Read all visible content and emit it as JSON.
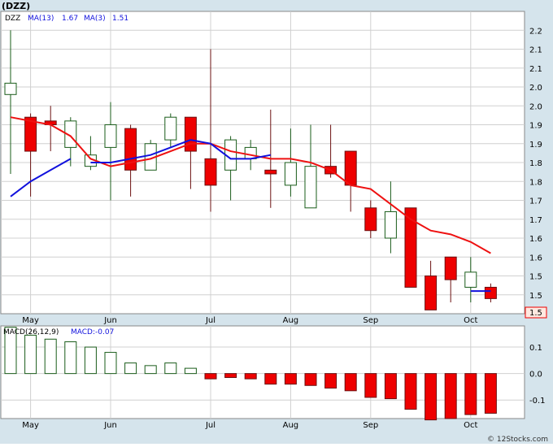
{
  "title": "(DZZ)",
  "colors": {
    "frame_bg": "#d5e4ec",
    "plot_bg": "#ffffff",
    "grid": "#d0d0d0",
    "up": "#1a5c1a",
    "down": "#ee0000",
    "ma13": "#ee1111",
    "ma3": "#1111dd",
    "price_box": "#ffe8e0"
  },
  "legend": {
    "ticker": "DZZ",
    "ma13_label": "MA(13)",
    "ma13_value": "1.67",
    "ma3_label": "MA(3)",
    "ma3_value": "1.51"
  },
  "last_price_label": "1.5",
  "macd_legend": {
    "label": "MACD(26,12,9)",
    "value_label": "MACD:-0.07"
  },
  "watermark": "© 12Stocks.com",
  "x_months": [
    {
      "label": "May",
      "i": 1
    },
    {
      "label": "Jun",
      "i": 5
    },
    {
      "label": "Jul",
      "i": 10
    },
    {
      "label": "Aug",
      "i": 14
    },
    {
      "label": "Sep",
      "i": 18
    },
    {
      "label": "Oct",
      "i": 23
    }
  ],
  "chart_data": [
    {
      "type": "candlestick",
      "ylim": [
        1.46,
        2.26
      ],
      "y_ticks": [
        "1.5",
        "1.5",
        "1.6",
        "1.6",
        "1.7",
        "1.7",
        "1.8",
        "1.8",
        "1.9",
        "1.9",
        "2.0",
        "2.0",
        "2.1",
        "2.1",
        "2.2"
      ],
      "y_tick_values": [
        1.51,
        1.56,
        1.61,
        1.66,
        1.71,
        1.76,
        1.81,
        1.86,
        1.91,
        1.96,
        2.01,
        2.06,
        2.11,
        2.16,
        2.21
      ],
      "candles": [
        {
          "o": 2.04,
          "c": 2.07,
          "h": 2.21,
          "l": 1.83
        },
        {
          "o": 1.98,
          "c": 1.89,
          "h": 1.99,
          "l": 1.77
        },
        {
          "o": 1.97,
          "c": 1.96,
          "h": 2.01,
          "l": 1.89
        },
        {
          "o": 1.9,
          "c": 1.97,
          "h": 1.98,
          "l": 1.85
        },
        {
          "o": 1.85,
          "c": 1.88,
          "h": 1.93,
          "l": 1.84
        },
        {
          "o": 1.9,
          "c": 1.96,
          "h": 2.02,
          "l": 1.76
        },
        {
          "o": 1.95,
          "c": 1.84,
          "h": 1.96,
          "l": 1.77
        },
        {
          "o": 1.84,
          "c": 1.91,
          "h": 1.92,
          "l": 1.84
        },
        {
          "o": 1.92,
          "c": 1.98,
          "h": 1.99,
          "l": 1.9
        },
        {
          "o": 1.98,
          "c": 1.89,
          "h": 1.98,
          "l": 1.79
        },
        {
          "o": 1.87,
          "c": 1.8,
          "h": 2.16,
          "l": 1.73
        },
        {
          "o": 1.84,
          "c": 1.92,
          "h": 1.93,
          "l": 1.76
        },
        {
          "o": 1.87,
          "c": 1.9,
          "h": 1.92,
          "l": 1.84
        },
        {
          "o": 1.84,
          "c": 1.83,
          "h": 2.0,
          "l": 1.74
        },
        {
          "o": 1.8,
          "c": 1.86,
          "h": 1.95,
          "l": 1.77
        },
        {
          "o": 1.74,
          "c": 1.85,
          "h": 1.96,
          "l": 1.74
        },
        {
          "o": 1.85,
          "c": 1.83,
          "h": 1.96,
          "l": 1.82
        },
        {
          "o": 1.89,
          "c": 1.8,
          "h": 1.89,
          "l": 1.73
        },
        {
          "o": 1.74,
          "c": 1.68,
          "h": 1.76,
          "l": 1.66
        },
        {
          "o": 1.66,
          "c": 1.73,
          "h": 1.81,
          "l": 1.62
        },
        {
          "o": 1.74,
          "c": 1.53,
          "h": 1.74,
          "l": 1.53
        },
        {
          "o": 1.56,
          "c": 1.47,
          "h": 1.6,
          "l": 1.47
        },
        {
          "o": 1.61,
          "c": 1.55,
          "h": 1.61,
          "l": 1.49
        },
        {
          "o": 1.53,
          "c": 1.57,
          "h": 1.61,
          "l": 1.49
        },
        {
          "o": 1.53,
          "c": 1.5,
          "h": 1.54,
          "l": 1.49
        }
      ],
      "ma13": [
        1.98,
        1.97,
        1.96,
        1.93,
        1.87,
        1.85,
        1.86,
        1.87,
        1.89,
        1.91,
        1.91,
        1.89,
        1.88,
        1.87,
        1.87,
        1.86,
        1.84,
        1.8,
        1.79,
        1.75,
        1.71,
        1.68,
        1.67,
        1.65,
        1.62
      ],
      "ma3": [
        1.77,
        1.81,
        1.84,
        1.87,
        1.86,
        1.86,
        1.87,
        1.88,
        1.9,
        1.92,
        1.91,
        1.87,
        1.87,
        1.88,
        null,
        null,
        null,
        null,
        null,
        null,
        null,
        null,
        null,
        1.52,
        1.52
      ],
      "ma3_segments": [
        [
          0,
          3
        ],
        [
          4,
          6
        ],
        [
          6,
          9
        ],
        [
          9,
          13
        ],
        [
          22,
          24
        ]
      ]
    },
    {
      "type": "bar",
      "name": "MACD(26,12,9)",
      "ylim": [
        -0.17,
        0.18
      ],
      "y_ticks": [
        "0.1",
        "0.0",
        "-0.1"
      ],
      "y_tick_values": [
        0.1,
        0.0,
        -0.1
      ],
      "values": [
        0.175,
        0.145,
        0.13,
        0.12,
        0.1,
        0.08,
        0.04,
        0.03,
        0.04,
        0.02,
        -0.02,
        -0.015,
        -0.02,
        -0.04,
        -0.04,
        -0.045,
        -0.055,
        -0.065,
        -0.09,
        -0.095,
        -0.135,
        -0.175,
        -0.17,
        -0.155,
        -0.15
      ]
    }
  ]
}
